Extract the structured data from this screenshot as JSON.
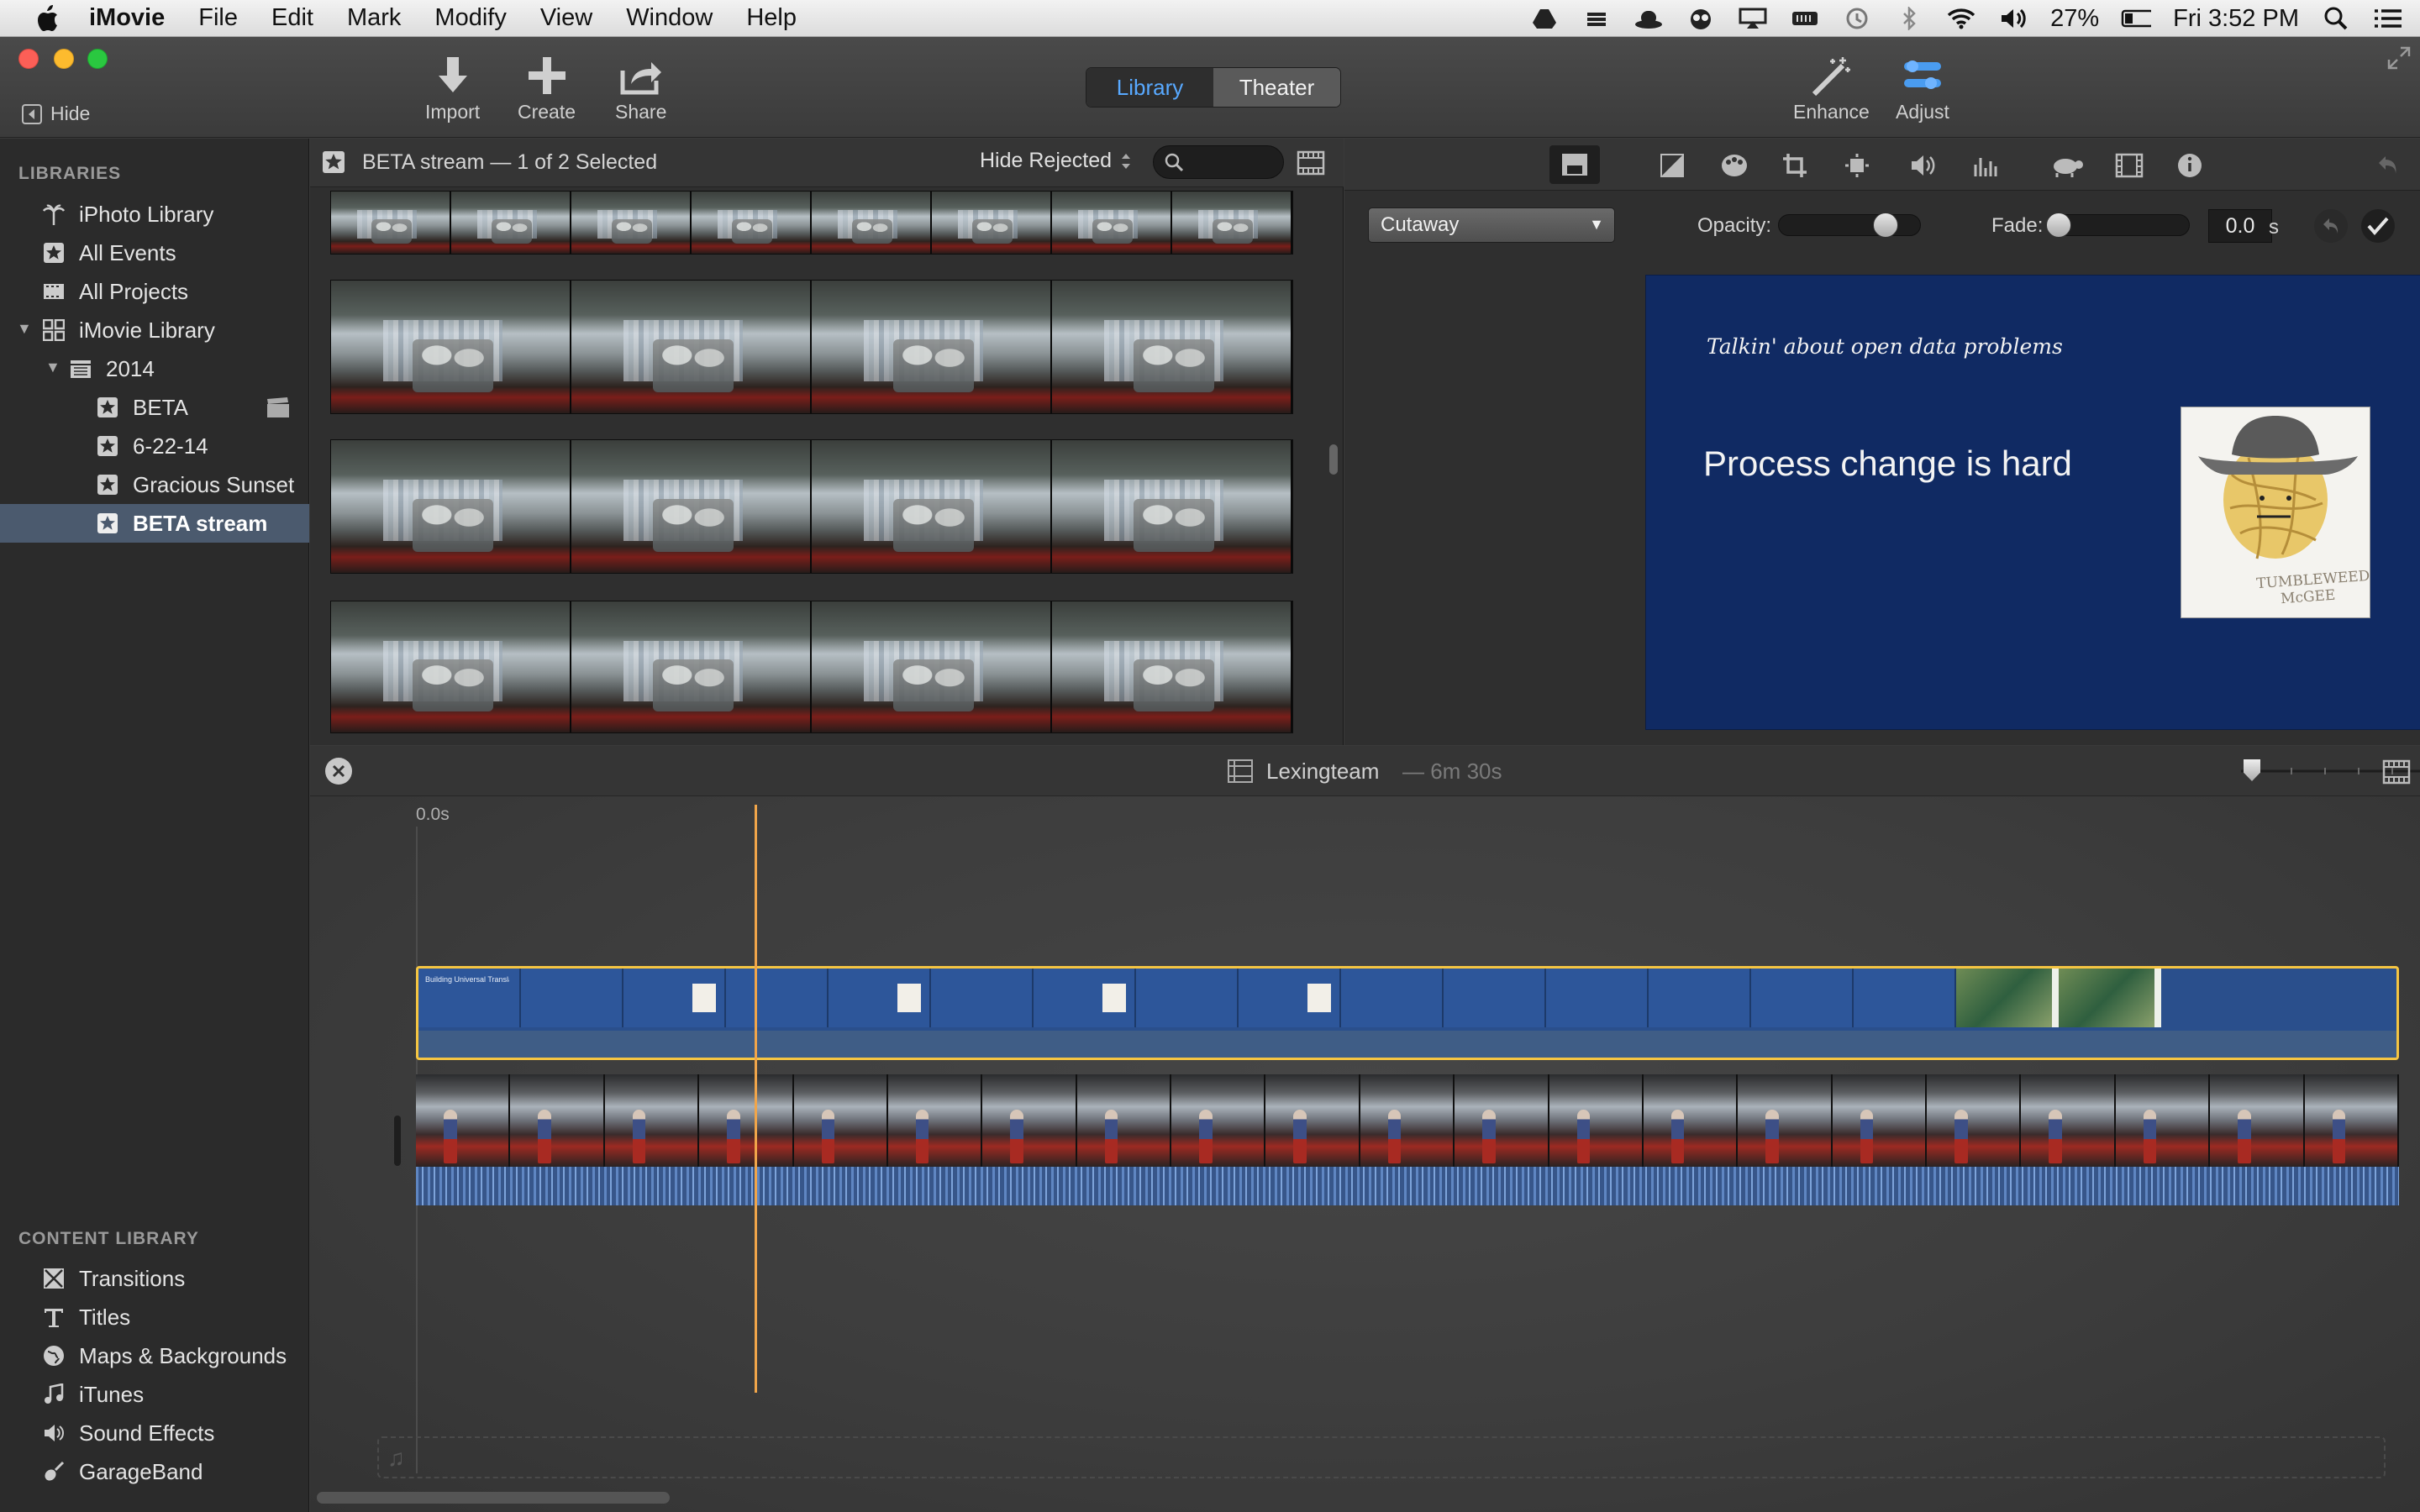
{
  "menubar": {
    "app_name": "iMovie",
    "menus": [
      "File",
      "Edit",
      "Mark",
      "Modify",
      "View",
      "Window",
      "Help"
    ],
    "battery": "27%",
    "clock": "Fri 3:52 PM"
  },
  "toolbar": {
    "hide_label": "Hide",
    "import_label": "Import",
    "create_label": "Create",
    "share_label": "Share",
    "library_tab": "Library",
    "theater_tab": "Theater",
    "enhance_label": "Enhance",
    "adjust_label": "Adjust"
  },
  "sidebar": {
    "libraries_heading": "LIBRARIES",
    "items": [
      {
        "label": "iPhoto Library",
        "icon": "palm-tree-icon"
      },
      {
        "label": "All Events",
        "icon": "star-icon"
      },
      {
        "label": "All Projects",
        "icon": "film-icon"
      },
      {
        "label": "iMovie Library",
        "icon": "grid-icon"
      },
      {
        "label": "2014",
        "icon": "calendar-icon"
      },
      {
        "label": "BETA",
        "icon": "star-icon"
      },
      {
        "label": "6-22-14",
        "icon": "star-icon"
      },
      {
        "label": "Gracious Sunset",
        "icon": "star-icon"
      },
      {
        "label": "BETA stream",
        "icon": "star-icon"
      }
    ],
    "content_heading": "CONTENT LIBRARY",
    "content_items": [
      {
        "label": "Transitions",
        "icon": "transitions-icon"
      },
      {
        "label": "Titles",
        "icon": "titles-icon"
      },
      {
        "label": "Maps & Backgrounds",
        "icon": "globe-icon"
      },
      {
        "label": "iTunes",
        "icon": "music-note-icon"
      },
      {
        "label": "Sound Effects",
        "icon": "speaker-icon"
      },
      {
        "label": "GarageBand",
        "icon": "guitar-icon"
      }
    ]
  },
  "browser": {
    "event_title": "BETA stream",
    "selection": "— 1 of 2 Selected",
    "filter": "Hide Rejected"
  },
  "viewer": {
    "overlay_mode": "Cutaway",
    "opacity_label": "Opacity:",
    "opacity_value": 0.8,
    "fade_label": "Fade:",
    "fade_value": "0.0",
    "fade_unit": "s",
    "slide": {
      "caption": "Talkin' about open data problems",
      "headline": "Process change is hard",
      "photo_caption": "TUMBLEWEED McGEE"
    }
  },
  "timeline": {
    "project_name": "Lexingteam",
    "duration": "— 6m 30s",
    "start_time": "0.0s",
    "first_slide_title": "Building Universal Translators"
  },
  "colors": {
    "accent_blue": "#58a9ff",
    "playhead": "#f0a54a",
    "selection_yellow": "#f5c542",
    "slide_blue": "#102a63"
  }
}
